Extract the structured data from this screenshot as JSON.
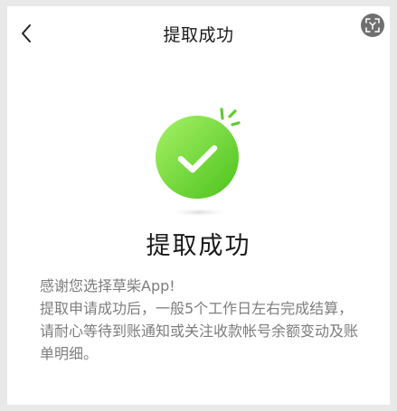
{
  "header": {
    "title": "提取成功",
    "back_icon": "chevron-left-icon",
    "scan_icon": "scan-icon"
  },
  "main": {
    "status_icon": "success-check-icon",
    "title": "提取成功",
    "lines": [
      "感谢您选择草柴App!",
      "提取申请成功后，一般5个工作日左右完成结算，请耐心等待到账通知或关注收款帐号余额变动及账单明细。"
    ]
  },
  "colors": {
    "accent_green": "#52c41a",
    "accent_green_light": "#9bef5c",
    "title_text": "#1a1a1a",
    "body_text": "#7d7d7d"
  }
}
